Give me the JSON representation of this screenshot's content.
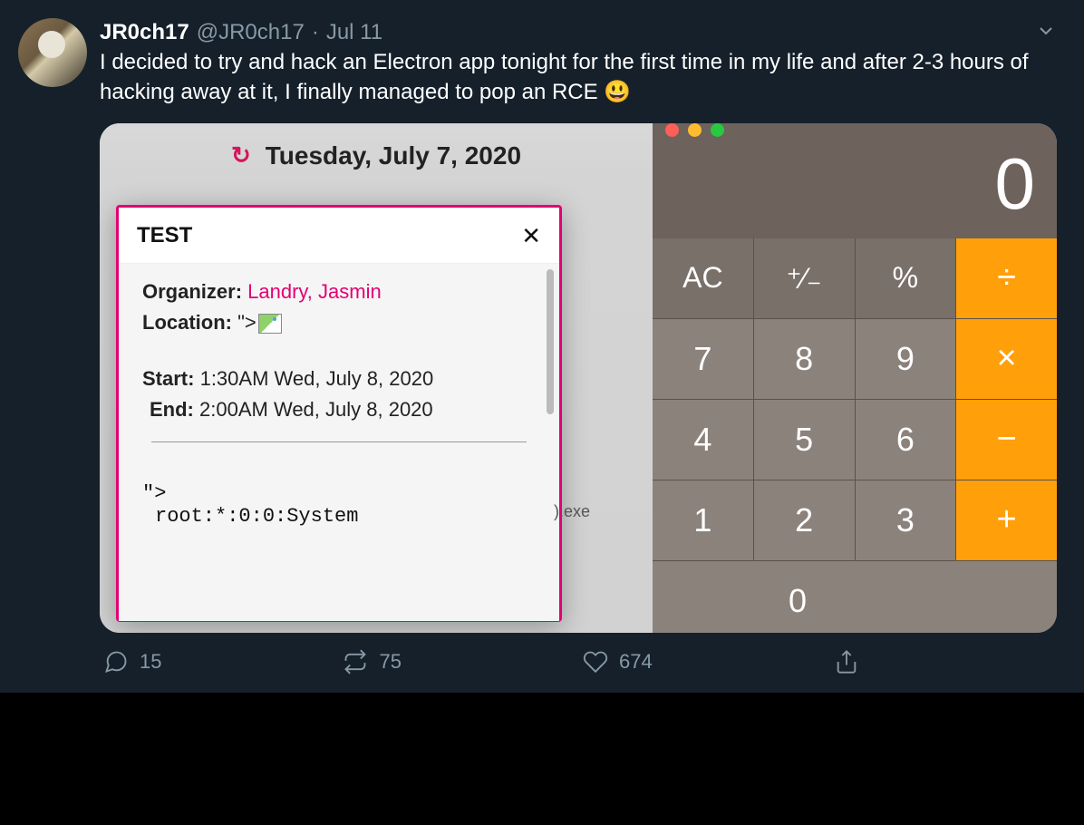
{
  "tweet": {
    "name": "JR0ch17",
    "handle": "@JR0ch17",
    "dot": "·",
    "date": "Jul 11",
    "text": "I decided to try and hack an Electron app tonight for the first time in my life and after 2-3 hours of hacking away at it, I finally managed to pop an RCE 😃",
    "replies": "15",
    "retweets": "75",
    "likes": "674"
  },
  "calendar": {
    "date_header": "Tuesday, July 7, 2020",
    "event_title": "TEST",
    "organizer_label": "Organizer:",
    "organizer_name": "Landry, Jasmin",
    "location_label": "Location:",
    "location_value": "\">",
    "start_label": "Start:",
    "start_value": "1:30AM Wed, July 8, 2020",
    "end_label": "End:",
    "end_value": "2:00AM Wed, July 8, 2020",
    "payload_prefix": "\">",
    "payload_line": "root:*:0:0:System",
    "exe_fragment": ").exe"
  },
  "calculator": {
    "display": "0",
    "keys": {
      "ac": "AC",
      "pm": "⁺⁄₋",
      "pct": "%",
      "div": "÷",
      "k7": "7",
      "k8": "8",
      "k9": "9",
      "mul": "×",
      "k4": "4",
      "k5": "5",
      "k6": "6",
      "sub": "−",
      "k1": "1",
      "k2": "2",
      "k3": "3",
      "add": "+",
      "k0": "0"
    }
  }
}
